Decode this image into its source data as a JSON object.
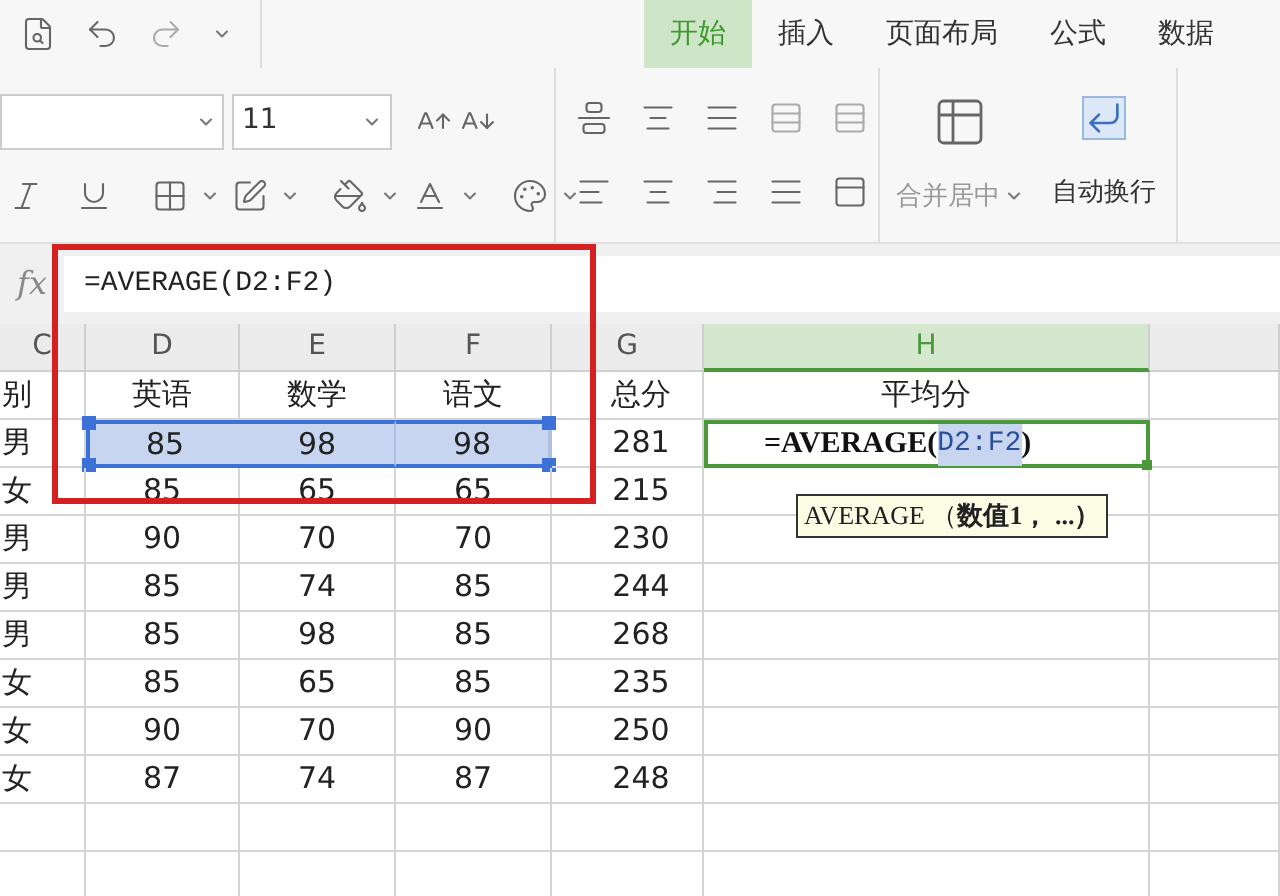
{
  "tabs": [
    {
      "label": "开始",
      "selected": true
    },
    {
      "label": "插入",
      "selected": false
    },
    {
      "label": "页面布局",
      "selected": false
    },
    {
      "label": "公式",
      "selected": false
    },
    {
      "label": "数据",
      "selected": false
    }
  ],
  "ribbon": {
    "font_size": "11",
    "merge_button": "合并居中",
    "wrap_button": "自动换行"
  },
  "formula_bar": {
    "label": "fx",
    "formula": "=AVERAGE(D2:F2)"
  },
  "sheet": {
    "columns": [
      {
        "label": "C",
        "selected": false
      },
      {
        "label": "D",
        "selected": false
      },
      {
        "label": "E",
        "selected": false
      },
      {
        "label": "F",
        "selected": false
      },
      {
        "label": "G",
        "selected": false
      },
      {
        "label": "H",
        "selected": true
      }
    ],
    "rows": [
      {
        "cells": [
          {
            "text": "别",
            "selected": false
          },
          {
            "text": "英语",
            "selected": false
          },
          {
            "text": "数学",
            "selected": false
          },
          {
            "text": "语文",
            "selected": false
          },
          {
            "text": "总分",
            "selected": false
          }
        ],
        "average": {
          "kind": "text",
          "text": "平均分"
        }
      },
      {
        "cells": [
          {
            "text": "男",
            "selected": false
          },
          {
            "text": "85",
            "selected": true
          },
          {
            "text": "98",
            "selected": true
          },
          {
            "text": "98",
            "selected": true
          },
          {
            "text": "281",
            "selected": false
          }
        ],
        "average": {
          "kind": "editor",
          "before": "=AVERAGE(",
          "reference": "D2:F2",
          "after": ")"
        }
      },
      {
        "cells": [
          {
            "text": "女",
            "selected": false
          },
          {
            "text": "85",
            "selected": false
          },
          {
            "text": "65",
            "selected": false
          },
          {
            "text": "65",
            "selected": false
          },
          {
            "text": "215",
            "selected": false
          }
        ]
      },
      {
        "cells": [
          {
            "text": "男",
            "selected": false
          },
          {
            "text": "90",
            "selected": false
          },
          {
            "text": "70",
            "selected": false
          },
          {
            "text": "70",
            "selected": false
          },
          {
            "text": "230",
            "selected": false
          }
        ]
      },
      {
        "cells": [
          {
            "text": "男",
            "selected": false
          },
          {
            "text": "85",
            "selected": false
          },
          {
            "text": "74",
            "selected": false
          },
          {
            "text": "85",
            "selected": false
          },
          {
            "text": "244",
            "selected": false
          }
        ]
      },
      {
        "cells": [
          {
            "text": "男",
            "selected": false
          },
          {
            "text": "85",
            "selected": false
          },
          {
            "text": "98",
            "selected": false
          },
          {
            "text": "85",
            "selected": false
          },
          {
            "text": "268",
            "selected": false
          }
        ]
      },
      {
        "cells": [
          {
            "text": "女",
            "selected": false
          },
          {
            "text": "85",
            "selected": false
          },
          {
            "text": "65",
            "selected": false
          },
          {
            "text": "85",
            "selected": false
          },
          {
            "text": "235",
            "selected": false
          }
        ]
      },
      {
        "cells": [
          {
            "text": "女",
            "selected": false
          },
          {
            "text": "90",
            "selected": false
          },
          {
            "text": "70",
            "selected": false
          },
          {
            "text": "90",
            "selected": false
          },
          {
            "text": "250",
            "selected": false
          }
        ]
      },
      {
        "cells": [
          {
            "text": "女",
            "selected": false
          },
          {
            "text": "87",
            "selected": false
          },
          {
            "text": "74",
            "selected": false
          },
          {
            "text": "87",
            "selected": false
          },
          {
            "text": "248",
            "selected": false
          }
        ]
      }
    ],
    "tooltip": "AVERAGE （**数值1， ...）**"
  }
}
